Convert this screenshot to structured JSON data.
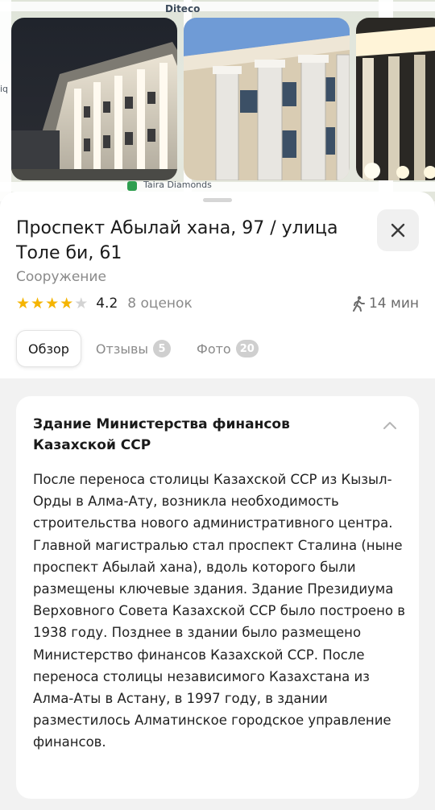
{
  "map": {
    "labels": [
      "Diteco",
      "Taira Diamonds",
      "iq"
    ]
  },
  "place": {
    "title": "Проспект Абылай хана, 97 / улица Толе би, 61",
    "category": "Сооружение",
    "rating": "4.2",
    "rating_stars": 4,
    "reviews": "8 оценок",
    "walk_time": "14 мин"
  },
  "icons": {
    "close": "close-icon",
    "walk": "walking-person-icon",
    "collapse": "chevron-up-icon",
    "star": "star-icon"
  },
  "tabs": [
    {
      "label": "Обзор",
      "count": ""
    },
    {
      "label": "Отзывы",
      "count": "5"
    },
    {
      "label": "Фото",
      "count": "20"
    }
  ],
  "description": {
    "title": "Здание Министерства финансов Казахской ССР",
    "body": "После переноса столицы Казахской ССР из Кызыл-Орды в Алма-Ату, возникла необходимость строительства нового административного центра. Главной магистралью стал проспект Сталина (ныне проспект Абылай хана), вдоль которого были размещены ключевые здания. Здание Президиума Верховного Совета Казахской ССР было построено в 1938 году. Позднее в здании было размещено Министерство финансов Казахской ССР. После переноса столицы независимого Казахстана из Алма-Аты в Астану, в 1997 году, в здании разместилось Алматинское городское управление финансов."
  },
  "colors": {
    "star": "#f5b400",
    "badge": "#cfcfcf",
    "poi": "#2e9e4f"
  }
}
